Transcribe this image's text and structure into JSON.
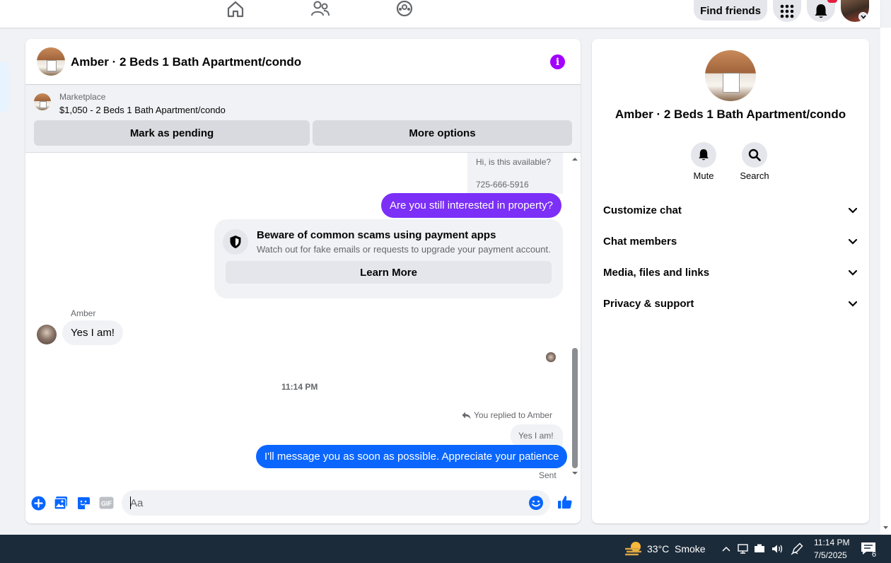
{
  "topbar": {
    "find_friends": "Find friends"
  },
  "chat": {
    "title": "Amber · 2 Beds 1 Bath Apartment/condo",
    "marketplace": {
      "label": "Marketplace",
      "listing": "$1,050 - 2 Beds 1 Bath Apartment/condo",
      "mark_pending": "Mark as pending",
      "more_options": "More options"
    },
    "messages": {
      "quoted_1": "Hi, is this available?",
      "quoted_2": "725-666-5916",
      "sent_1": "Are you still interested in property?",
      "scam_title": "Beware of common scams using payment apps",
      "scam_desc": "Watch out for fake emails or requests to upgrade your payment account.",
      "learn_more": "Learn More",
      "sender_name": "Amber",
      "received_1": "Yes I am!",
      "timestamp": "11:14 PM",
      "replied_to": "You replied to Amber",
      "reply_quote": "Yes I am!",
      "sent_2": "I'll message you as soon as possible. Appreciate your patience",
      "status": "Sent"
    },
    "composer": {
      "placeholder": "Aa"
    }
  },
  "info_panel": {
    "title": "Amber · 2 Beds 1 Bath Apartment/condo",
    "mute": "Mute",
    "search": "Search",
    "sections": [
      "Customize chat",
      "Chat members",
      "Media, files and links",
      "Privacy & support"
    ]
  },
  "taskbar": {
    "weather": "33°C",
    "condition": "Smoke",
    "time": "11:14 PM",
    "date": "7/5/2025",
    "notifications": "6"
  },
  "colors": {
    "accent": "#0866ff",
    "purple_bubble": "#7b2ff7",
    "blue_bubble": "#0a66ff",
    "info": "#a200ff"
  }
}
